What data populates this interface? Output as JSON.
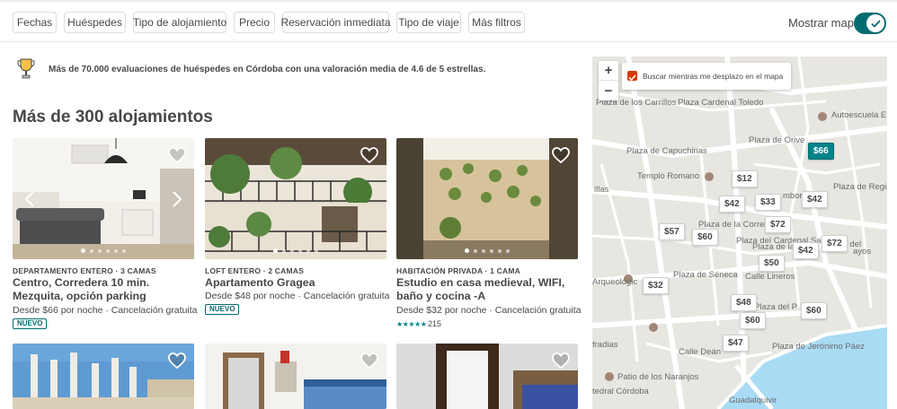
{
  "filters": [
    "Fechas",
    "Huéspedes",
    "Tipo de alojamiento",
    "Precio",
    "Reservación inmediata",
    "Tipo de viaje",
    "Más filtros"
  ],
  "map_toggle": {
    "label": "Mostrar mapa",
    "on": true
  },
  "banner": "Más de 70.000 evaluaciones de huéspedes en Córdoba con una valoración media de 4.6 de 5 estrellas.",
  "heading": "Más de 300 alojamientos",
  "listings": [
    {
      "kind": "DEPARTAMENTO ENTERO · 3 CAMAS",
      "title": "Centro, Corredera 10 min. Mezquita, opción parking",
      "price": "Desde  $66  por noche · Cancelación gratuita",
      "badge": "NUEVO"
    },
    {
      "kind": "LOFT ENTERO · 2 CAMAS",
      "title": "Apartamento Gragea",
      "price": "Desde  $48  por noche · Cancelación gratuita",
      "badge": "NUEVO"
    },
    {
      "kind": "HABITACIÓN PRIVADA · 1 CAMA",
      "title": "Estudio en casa medieval, WIFI, baño y cocina -A",
      "price": "Desde  $32  por noche · Cancelación gratuita",
      "rating": 4.5,
      "stars": "★★★★★",
      "reviews": "215"
    }
  ],
  "map": {
    "zoom_in": "+",
    "zoom_out": "−",
    "search_label": "Buscar mientras me desplazo en el mapa",
    "search_checked": true,
    "pins": [
      {
        "price": "$66",
        "selected": true
      },
      {
        "price": "$12"
      },
      {
        "price": "$42"
      },
      {
        "price": "$33"
      },
      {
        "price": "$42"
      },
      {
        "price": "$72"
      },
      {
        "price": "$57"
      },
      {
        "price": "$60"
      },
      {
        "price": "$42"
      },
      {
        "price": "$72"
      },
      {
        "price": "$50"
      },
      {
        "price": "$32"
      },
      {
        "price": "$48"
      },
      {
        "price": "$60"
      },
      {
        "price": "$60"
      },
      {
        "price": "$47"
      }
    ],
    "labels": [
      "Plaza de los Carrillos",
      "Plaza Cardenal Toledo",
      "Autoescuela E",
      "Plaza de Orive",
      "Plaza de Capuchinas",
      "Templo Romano",
      "illas",
      "Plaza del Cardenal Salazar",
      "Plaza de la Corredera",
      "mbor",
      "Plaza de Regina",
      "Plaza de la",
      "Plaza del",
      "ayos",
      "Plaza de Séneca",
      "Arqueológic",
      "Plaza del P",
      "Plaza de Jerónimo Páez",
      "Calle Lineros",
      "Patio de los Naranjos",
      "tedral Córdoba",
      "Calle Deán",
      "Guadalquivir",
      "fradias"
    ]
  },
  "colors": {
    "teal": "#008489",
    "dark_teal": "#006c70",
    "text": "#484848",
    "checkbox": "#d93900"
  }
}
